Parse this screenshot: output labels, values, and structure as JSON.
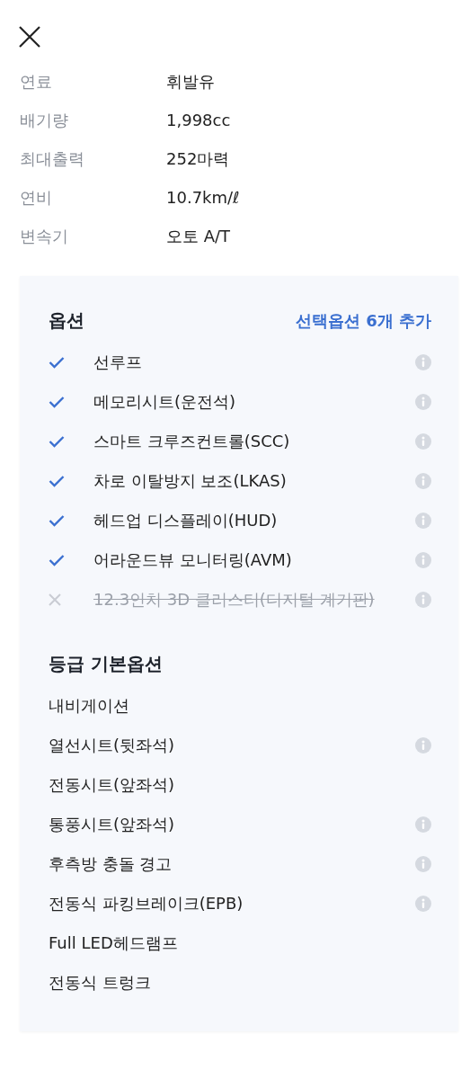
{
  "specs": [
    {
      "label": "연료",
      "value": "휘발유"
    },
    {
      "label": "배기량",
      "value": "1,998cc"
    },
    {
      "label": "최대출력",
      "value": "252마력"
    },
    {
      "label": "연비",
      "value": "10.7km/ℓ"
    },
    {
      "label": "변속기",
      "value": "오토 A/T"
    }
  ],
  "options": {
    "title": "옵션",
    "link": "선택옵션 6개 추가",
    "items": [
      {
        "label": "선루프",
        "included": true,
        "info": true
      },
      {
        "label": "메모리시트(운전석)",
        "included": true,
        "info": true
      },
      {
        "label": "스마트 크루즈컨트롤(SCC)",
        "included": true,
        "info": true
      },
      {
        "label": "차로 이탈방지 보조(LKAS)",
        "included": true,
        "info": true
      },
      {
        "label": "헤드업 디스플레이(HUD)",
        "included": true,
        "info": true
      },
      {
        "label": "어라운드뷰 모니터링(AVM)",
        "included": true,
        "info": true
      },
      {
        "label": "12.3인치 3D 클러스터(디지털 계기판)",
        "included": false,
        "info": true
      }
    ]
  },
  "basic_options": {
    "title": "등급 기본옵션",
    "items": [
      {
        "label": "내비게이션",
        "info": false
      },
      {
        "label": "열선시트(뒷좌석)",
        "info": true
      },
      {
        "label": "전동시트(앞좌석)",
        "info": false
      },
      {
        "label": "통풍시트(앞좌석)",
        "info": true
      },
      {
        "label": "후측방 충돌 경고",
        "info": true
      },
      {
        "label": "전동식 파킹브레이크(EPB)",
        "info": true
      },
      {
        "label": "Full LED헤드램프",
        "info": false
      },
      {
        "label": "전동식 트렁크",
        "info": false
      }
    ]
  }
}
